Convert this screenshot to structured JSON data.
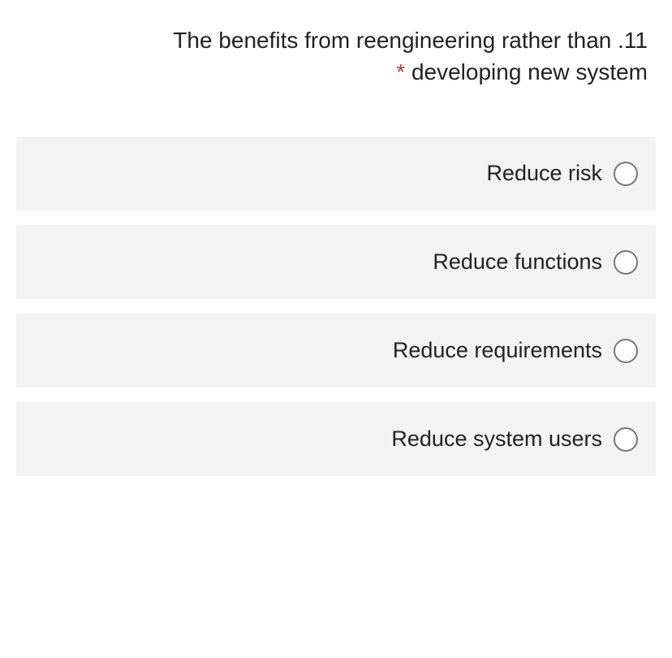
{
  "question": {
    "number": ".11",
    "text_line1": "The benefits from reengineering rather than",
    "text_line2": "developing new system",
    "required_marker": "*"
  },
  "options": [
    {
      "label": "Reduce risk"
    },
    {
      "label": "Reduce functions"
    },
    {
      "label": "Reduce requirements"
    },
    {
      "label": "Reduce system users"
    }
  ]
}
